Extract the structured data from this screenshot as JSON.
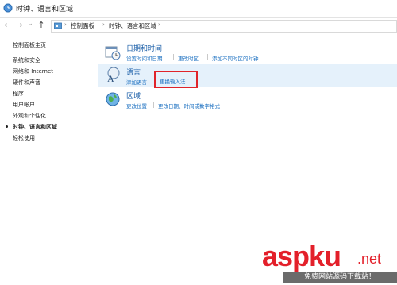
{
  "window": {
    "title": "时钟、语言和区域"
  },
  "address": {
    "crumbs": [
      "控制面板",
      "时钟、语言和区域"
    ],
    "nav": {
      "back": "←",
      "forward": "→",
      "down": "⌄",
      "up": "↑"
    }
  },
  "sidebar": {
    "items": [
      {
        "label": "控制面板主页"
      },
      {
        "label": "系统和安全"
      },
      {
        "label": "网络和 Internet"
      },
      {
        "label": "硬件和声音"
      },
      {
        "label": "程序"
      },
      {
        "label": "用户帐户"
      },
      {
        "label": "外观和个性化"
      },
      {
        "label": "时钟、语言和区域"
      },
      {
        "label": "轻松使用"
      }
    ],
    "current_index": 7
  },
  "categories": [
    {
      "title": "日期和时间",
      "links": [
        "设置时间和日期",
        "更改时区",
        "添加不同时区的时钟"
      ]
    },
    {
      "title": "语言",
      "links": [
        "添加语言",
        "更换输入法"
      ]
    },
    {
      "title": "区域",
      "links": [
        "更改位置",
        "更改日期、时间或数字格式"
      ]
    }
  ],
  "watermark": {
    "brand": "aspku",
    "tld": ".net",
    "sub": "免费网站源码下载站！"
  },
  "colors": {
    "link": "#1a6fc0",
    "title": "#1a5ea8",
    "highlight_border": "#e0242a",
    "selected_row": "#e5f1fb"
  }
}
